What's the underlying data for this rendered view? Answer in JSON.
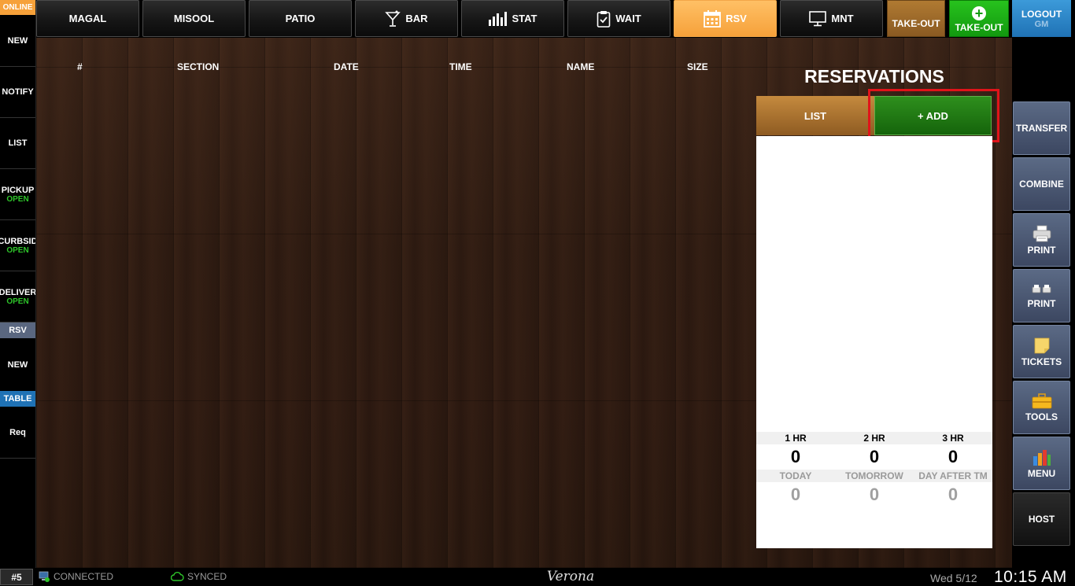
{
  "top_tabs": [
    {
      "label": "MAGAL",
      "icon": ""
    },
    {
      "label": "MISOOL",
      "icon": ""
    },
    {
      "label": "PATIO",
      "icon": ""
    },
    {
      "label": "BAR",
      "icon": "cocktail-icon"
    },
    {
      "label": "STAT",
      "icon": "bar-chart-icon"
    },
    {
      "label": "WAIT",
      "icon": "clipboard-icon"
    },
    {
      "label": "RSV",
      "icon": "calendar-icon",
      "active": true
    },
    {
      "label": "MNT",
      "icon": "monitor-icon"
    }
  ],
  "takeout_orange": "TAKE-OUT",
  "takeout_green": "TAKE-OUT",
  "logout": {
    "label": "LOGOUT",
    "user": "GM"
  },
  "sidebar": {
    "online": "ONLINE",
    "items": [
      {
        "label": "NEW",
        "status": ""
      },
      {
        "label": "NOTIFY",
        "status": ""
      },
      {
        "label": "LIST",
        "status": ""
      },
      {
        "label": "PICKUP",
        "status": "OPEN"
      },
      {
        "label": "CURBSID",
        "status": "OPEN"
      },
      {
        "label": "DELIVER",
        "status": "OPEN"
      }
    ],
    "rsv_badge": "RSV",
    "rsv_new": "NEW",
    "table_badge": "TABLE",
    "req": "Req"
  },
  "table_headers": [
    "#",
    "SECTION",
    "DATE",
    "TIME",
    "NAME",
    "SIZE"
  ],
  "reservations": {
    "title": "RESERVATIONS",
    "list_button": "LIST",
    "add_button": "+ ADD",
    "hour_labels": [
      "1 HR",
      "2 HR",
      "3 HR"
    ],
    "hour_values": [
      "0",
      "0",
      "0"
    ],
    "day_labels": [
      "TODAY",
      "TOMORROW",
      "DAY AFTER TM"
    ],
    "day_values": [
      "0",
      "0",
      "0"
    ]
  },
  "right_toolbar": [
    {
      "label": "TRANSFER",
      "icon": ""
    },
    {
      "label": "COMBINE",
      "icon": ""
    },
    {
      "label": "PRINT",
      "icon": "printer-icon"
    },
    {
      "label": "PRINT",
      "icon": "printers-icon"
    },
    {
      "label": "TICKETS",
      "icon": "sticky-note-icon"
    },
    {
      "label": "TOOLS",
      "icon": "toolbox-icon"
    },
    {
      "label": "MENU",
      "icon": "menu-chart-icon"
    },
    {
      "label": "HOST",
      "icon": ""
    }
  ],
  "status_bar": {
    "terminal": "#5",
    "connected": "CONNECTED",
    "synced": "SYNCED",
    "venue": "Verona",
    "date": "Wed 5/12",
    "time": "10:15 AM"
  },
  "colors": {
    "orange": "#f6a13a",
    "green": "#12990f",
    "blue": "#1f72b5",
    "highlight_red": "#e0141a",
    "open_green": "#2ec52a"
  }
}
